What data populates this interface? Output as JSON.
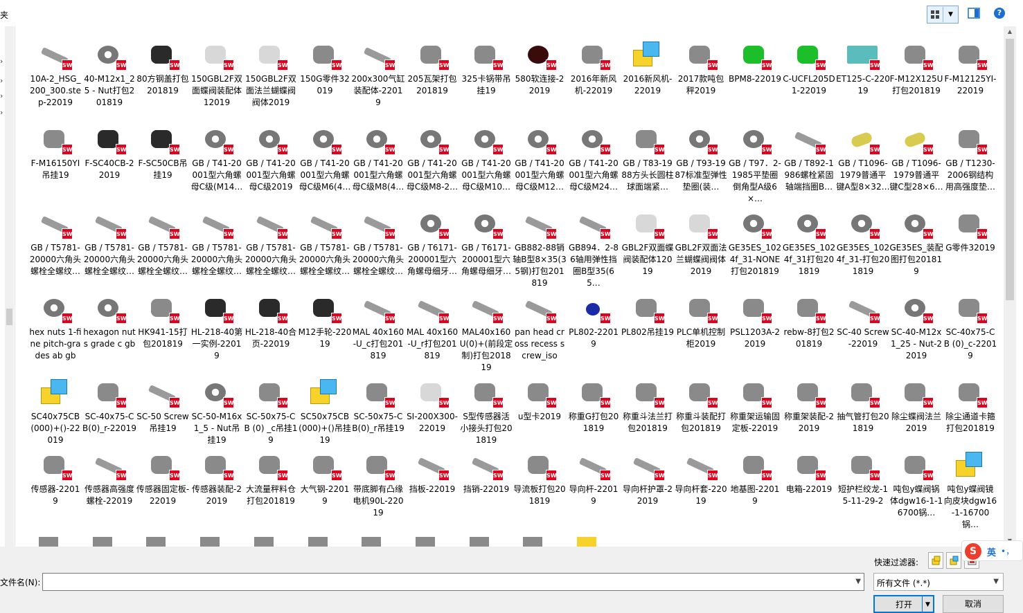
{
  "topbar": {
    "crumb": "夹",
    "help": "?"
  },
  "icons": {
    "sw_badge": "SW"
  },
  "files": [
    "10A-2_HSG_200_300.step-22019",
    "40-M12x1_25 - Nut打包201819",
    "80方钢盖打包201819",
    "150GBL2F双面蝶阀装配体12019",
    "150GBL2F双面法兰蝴蝶阀阀体2019",
    "150G零件32019",
    "200x300气缸装配体-22019",
    "205瓦架打包201819",
    "325卡锅带吊挂19",
    "580软连接-22019",
    "2016年新风机-22019",
    "2016新风机-22019",
    "2017款吨包秤2019",
    "BPM8-22019",
    "C-UCFL205D1-22019",
    "ET125-C-22019",
    "F-M12X125U打包201819",
    "F-M12125YI-22019",
    "F-M16150YI吊挂19",
    "F-SC40CB-22019",
    "F-SC50CB吊挂19",
    "GB / T41-20001型六角螺母C级(M14…",
    "GB / T41-20001型六角螺母C级2019",
    "GB / T41-20001型六角螺母C级M6(4…",
    "GB / T41-20001型六角螺母C级M8(4…",
    "GB / T41-20001型六角螺母C级M8-2…",
    "GB / T41-20001型六角螺母C级M10…",
    "GB / T41-20001型六角螺母C级M12…",
    "GB / T41-20001型六角螺母C级M24…",
    "GB / T83-1988方头长圆柱球面端紧…",
    "GB / T93-1987标准型弹性垫圈(装…",
    "GB / T97．2-1985平垫圈倒角型A级6×…",
    "GB / T892-1986螺栓紧固轴端挡圈B…",
    "GB / T1096-1979普通平键A型8×32…",
    "GB / T1096-1979普通平键C型28×6…",
    "GB / T1230-2006钢结构用高强度垫…",
    "GB / T5781-20000六角头螺栓全螺纹…",
    "GB / T5781-20000六角头螺栓全螺纹…",
    "GB / T5781-20000六角头螺栓全螺纹…",
    "GB / T5781-20000六角头螺栓全螺纹…",
    "GB / T5781-20000六角头螺栓全螺纹…",
    "GB / T5781-20000六角头螺栓全螺纹…",
    "GB / T5781-20000六角头螺栓全螺纹…",
    "GB / T6171-200001型六角螺母细牙…",
    "GB / T6171-200001型六角螺母细牙…",
    "GB882-88销轴B型8×35(35钢)打包201819",
    "GB894．2-86轴用弹性挡圈B型35(65…",
    "GBL2F双面蝶阀装配体12019",
    "GBL2F双面法兰蝴蝶阀阀体2019",
    "GE35ES_1024f_31-NONE打包201819",
    "GE35ES_1024f_31打包201819",
    "GE35ES_1024f_31-打包201819",
    "GE35ES_装配图打包201819",
    "G零件32019",
    "hex nuts 1-fine pitch-grades ab gb",
    "hexagon nuts grade c gb",
    "HK941-15打包201819",
    "HL-218-40第一实例-22019",
    "HL-218-40合页-22019",
    "M12手轮-22019",
    "MAL 40x160-U_c打包201819",
    "MAL 40x160-U_r打包201819",
    "MAL40x160U(0)+(前段定制)打包201819",
    "pan head cross recess screw_iso",
    "PL802-22019",
    "PL802吊挂19",
    "PLC单机控制柜2019",
    "PSL1203A-22019",
    "rebw-8打包201819",
    "SC-40 Screw-22019",
    "SC-40-M12x1_25 - Nut-22019",
    "SC-40x75-CB (0)_c-22019",
    "SC40x75CB(000)+()-22019",
    "SC-40x75-CB(0)_r-22019",
    "SC-50 Screw吊挂19",
    "SC-50-M16x1_5 - Nut吊挂19",
    "SC-50x75-CB (0) _c吊挂19",
    "SC50x75CB(000)+()吊挂19",
    "SC-50x75-CB(0)_r吊挂19",
    "SI-200X300-22019",
    "S型传感器活小接头打包201819",
    "u型卡2019",
    "称重G打包201819",
    "称重斗法兰打包201819",
    "称重斗装配打包201819",
    "称重架运输固定板-22019",
    "称重架装配-22019",
    "抽气管打包201819",
    "除尘蝶阀法兰2019",
    "除尘通道卡箍打包201819",
    "传感器-22019",
    "传感器高强度螺栓-22019",
    "传感器固定板-22019",
    "传感器装配-22019",
    "大流量秤料仓打包201819",
    "大气钢-22019",
    "带底脚有凸缘电机90L-22019",
    "挡板-22019",
    "挡销-22019",
    "导流板打包201819",
    "导向杆-22019",
    "导向杆护罩-22019",
    "导向杆套-22019",
    "地基图-22019",
    "电箱-22019",
    "短护栏绞龙-15-11-29-2",
    "吨包y蝶阀锅体dgw16-1-16700锅…",
    "吨包y蝶阀镜向皮块dgw16-1-16700锅…"
  ],
  "bottom": {
    "quick_filter_label": "快速过滤器:",
    "filename_label": "文件名(N):",
    "filename_value": "",
    "filetype_value": "所有文件 (*.*)",
    "open_label": "打开",
    "cancel_label": "取消"
  },
  "ime": {
    "logo": "S",
    "lang": "英",
    "dots": "•，"
  }
}
